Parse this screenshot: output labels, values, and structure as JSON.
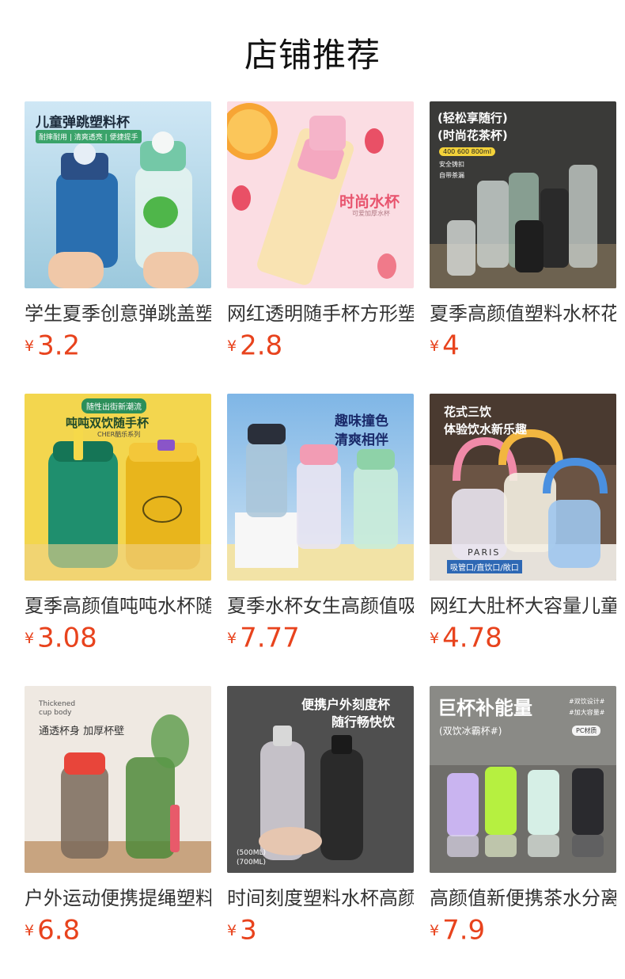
{
  "page": {
    "title": "店铺推荐"
  },
  "currency": "¥",
  "colors": {
    "price": "#e8431d"
  },
  "products": [
    {
      "name": "学生夏季创意弹跳盖塑料杯",
      "price": "3.2",
      "overlay": [
        "儿童弹跳塑料杯",
        "耐摔耐用 | 清爽透亮 | 便捷提手"
      ]
    },
    {
      "name": "网红透明随手杯方形塑料杯",
      "price": "2.8",
      "overlay": [
        "时尚水杯",
        "可爱加厚水杯"
      ]
    },
    {
      "name": "夏季高颜值塑料水杯花茶杯",
      "price": "4",
      "overlay": [
        "(轻松享随行)",
        "(时尚花茶杯)",
        "400 600 800ml",
        "安全铸扣",
        "自带茶漏"
      ]
    },
    {
      "name": "夏季高颜值吨吨水杯随手杯",
      "price": "3.08",
      "overlay": [
        "随性出街新潮流",
        "吨吨双饮随手杯",
        "CHER酷乐系列"
      ]
    },
    {
      "name": "夏季水杯女生高颜值吸管杯",
      "price": "7.77",
      "overlay": [
        "趣味撞色",
        "清爽相伴"
      ]
    },
    {
      "name": "网红大肚杯大容量儿童水杯",
      "price": "4.78",
      "overlay": [
        "花式三饮",
        "体验饮水新乐趣",
        "吸管口/直饮口/敞口",
        "PARIS"
      ]
    },
    {
      "name": "户外运动便携提绳塑料水杯",
      "price": "6.8",
      "overlay": [
        "Thickened",
        "cup body",
        "通透杯身 加厚杯壁"
      ]
    },
    {
      "name": "时间刻度塑料水杯高颜值",
      "price": "3",
      "overlay": [
        "便携户外刻度杯",
        "随行畅快饮",
        "(500ML)",
        "(700ML)"
      ]
    },
    {
      "name": "高颜值新便携茶水分离杯",
      "price": "7.9",
      "overlay": [
        "巨杯补能量",
        "(双饮冰霸杯#)",
        "#双饮设计#",
        "#加大容量#",
        "PC材质"
      ]
    }
  ]
}
